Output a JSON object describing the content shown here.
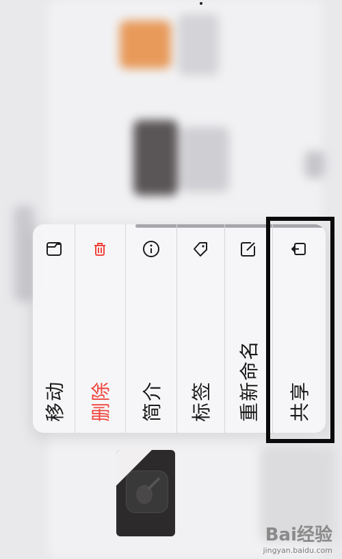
{
  "menu": {
    "items": [
      {
        "label": "移动",
        "icon": "folder-icon"
      },
      {
        "label": "删除",
        "icon": "trash-icon",
        "color": "#f0443a"
      },
      {
        "label": "简介",
        "icon": "info-icon"
      },
      {
        "label": "标签",
        "icon": "tag-icon"
      },
      {
        "label": "重新命名",
        "icon": "pencil-square-icon"
      },
      {
        "label": "共享",
        "icon": "share-icon"
      }
    ]
  },
  "highlight": {
    "target": "共享",
    "color": "#0a0a0a"
  },
  "watermark": {
    "brand": "Bai经验",
    "sub": "jingyan.baidu.com"
  },
  "colors": {
    "destructive": "#f0443a",
    "menu_bg": "#f6f6f8"
  }
}
